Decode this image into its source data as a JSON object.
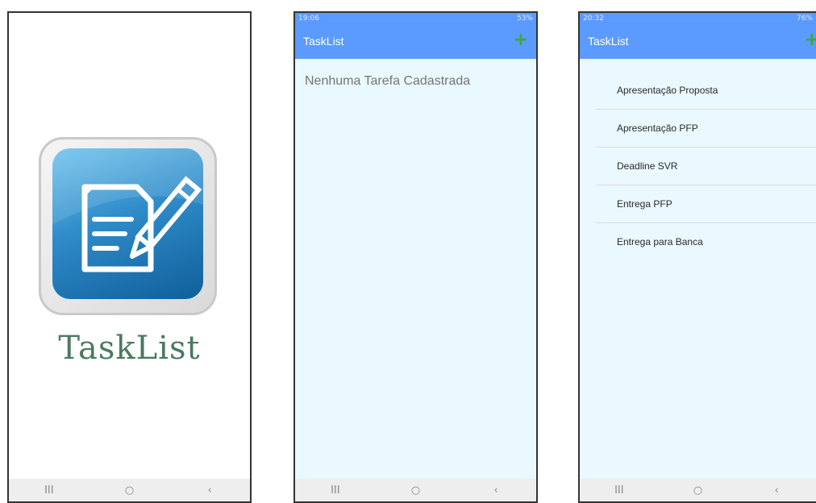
{
  "splash": {
    "title": "TaskList"
  },
  "empty_screen": {
    "status_time": "19:06",
    "status_right": "53%",
    "app_title": "TaskList",
    "add_label": "+",
    "message": "Nenhuma Tarefa Cadastrada"
  },
  "list_screen": {
    "status_time": "20:32",
    "status_right": "76%",
    "app_title": "TaskList",
    "add_label": "+",
    "tasks": [
      "Apresentação Proposta",
      "Apresentação PFP",
      "Deadline SVR",
      "Entrega PFP",
      "Entrega para Banca"
    ]
  },
  "navbar": {
    "recents": "III",
    "home": "○",
    "back": "‹"
  },
  "colors": {
    "appbar": "#5b9bff",
    "content_bg": "#eaf8ff",
    "add_icon": "#3ea833",
    "splash_text": "#4a7a5f"
  },
  "icons": [
    "document-pencil-icon",
    "plus-icon",
    "recents-icon",
    "home-icon",
    "back-icon"
  ]
}
